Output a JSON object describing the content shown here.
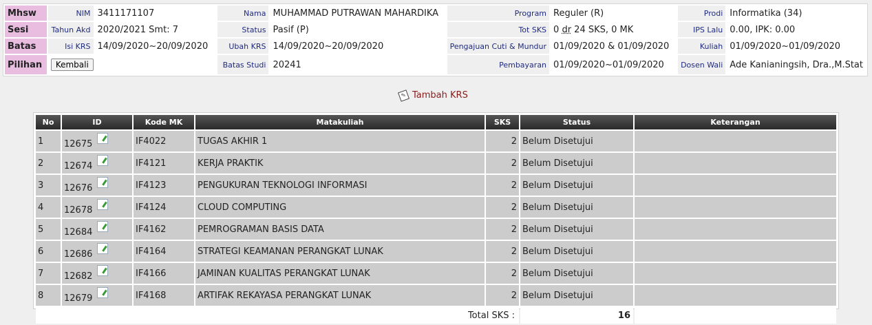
{
  "header": {
    "rows": [
      {
        "title": "Mhsw",
        "cells": [
          {
            "label": "NIM",
            "value": "3411171107"
          },
          {
            "label": "Nama",
            "value": "MUHAMMAD PUTRAWAN MAHARDIKA"
          },
          {
            "label": "Program",
            "value": "Reguler (R)"
          },
          {
            "label": "Prodi",
            "value": "Informatika (34)"
          }
        ]
      },
      {
        "title": "Sesi",
        "cells": [
          {
            "label": "Tahun Akd",
            "value": "2020/2021 Smt: 7"
          },
          {
            "label": "Status",
            "value": "Pasif (P)"
          },
          {
            "label": "Tot SKS",
            "value_pre": "0 ",
            "value_dr": "dr",
            "value_post": " 24 SKS, 0 MK"
          },
          {
            "label": "IPS Lalu",
            "value": "0.00, IPK: 0.00"
          }
        ]
      },
      {
        "title": "Batas",
        "cells": [
          {
            "label": "Isi KRS",
            "value": "14/09/2020~20/09/2020"
          },
          {
            "label": "Ubah KRS",
            "value": "14/09/2020~20/09/2020"
          },
          {
            "label": "Pengajuan Cuti & Mundur",
            "value": "01/09/2020 & 01/09/2020"
          },
          {
            "label": "Kuliah",
            "value": "01/09/2020~01/09/2020"
          }
        ]
      },
      {
        "title": "Pilihan",
        "button": "Kembali",
        "cells": [
          {
            "label": "Batas Studi",
            "value": "20241"
          },
          {
            "label": "Pembayaran",
            "value": "01/09/2020~01/09/2020"
          },
          {
            "label": "Dosen Wali",
            "value": "Ade Kanianingsih, Dra.,M.Stat"
          }
        ]
      }
    ]
  },
  "add_link": {
    "label": "Tambah KRS",
    "icon": "edit-note-icon"
  },
  "table": {
    "columns": [
      "No",
      "ID",
      "Kode MK",
      "Matakuliah",
      "SKS",
      "Status",
      "Keterangan"
    ],
    "rows": [
      {
        "no": "1",
        "id": "12675",
        "kode": "IF4022",
        "mk": "TUGAS AKHIR 1",
        "sks": "2",
        "status": "Belum Disetujui",
        "ket": ""
      },
      {
        "no": "2",
        "id": "12674",
        "kode": "IF4121",
        "mk": "KERJA PRAKTIK",
        "sks": "2",
        "status": "Belum Disetujui",
        "ket": ""
      },
      {
        "no": "3",
        "id": "12676",
        "kode": "IF4123",
        "mk": "PENGUKURAN TEKNOLOGI INFORMASI",
        "sks": "2",
        "status": "Belum Disetujui",
        "ket": ""
      },
      {
        "no": "4",
        "id": "12678",
        "kode": "IF4124",
        "mk": "CLOUD COMPUTING",
        "sks": "2",
        "status": "Belum Disetujui",
        "ket": ""
      },
      {
        "no": "5",
        "id": "12684",
        "kode": "IF4162",
        "mk": "PEMROGRAMAN BASIS DATA",
        "sks": "2",
        "status": "Belum Disetujui",
        "ket": ""
      },
      {
        "no": "6",
        "id": "12686",
        "kode": "IF4164",
        "mk": "STRATEGI KEAMANAN PERANGKAT LUNAK",
        "sks": "2",
        "status": "Belum Disetujui",
        "ket": ""
      },
      {
        "no": "7",
        "id": "12682",
        "kode": "IF4166",
        "mk": "JAMINAN KUALITAS PERANGKAT LUNAK",
        "sks": "2",
        "status": "Belum Disetujui",
        "ket": ""
      },
      {
        "no": "8",
        "id": "12679",
        "kode": "IF4168",
        "mk": "ARTIFAK REKAYASA PERANGKAT LUNAK",
        "sks": "2",
        "status": "Belum Disetujui",
        "ket": ""
      }
    ],
    "total_label": "Total SKS :",
    "total_value": "16"
  },
  "colors": {
    "header_label_bg": "#e8bde0",
    "label_text": "#1e2a80",
    "link": "#8b1a1a",
    "row_bg": "#cccccc"
  }
}
